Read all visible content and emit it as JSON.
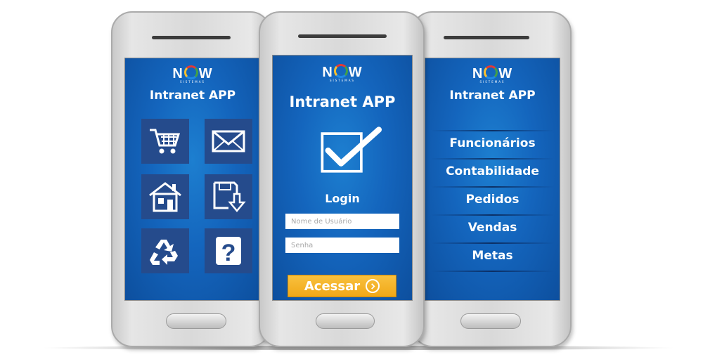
{
  "brand": {
    "logo_left": "N",
    "logo_right": "W",
    "logo_sub": "SISTEMAS"
  },
  "app_title": "Intranet APP",
  "phone1": {
    "tiles": [
      {
        "icon": "shopping-cart-icon"
      },
      {
        "icon": "envelope-icon"
      },
      {
        "icon": "house-icon"
      },
      {
        "icon": "save-download-icon"
      },
      {
        "icon": "recycle-icon"
      },
      {
        "icon": "help-question-icon"
      }
    ]
  },
  "phone2": {
    "check_icon": "checkbox-check-icon",
    "login_label": "Login",
    "username_placeholder": "Nome de Usuário",
    "password_placeholder": "Senha",
    "access_button": "Acessar"
  },
  "phone3": {
    "menu": [
      "Funcionários",
      "Contabilidade",
      "Pedidos",
      "Vendas",
      "Metas"
    ]
  },
  "colors": {
    "screen_blue": "#1465bd",
    "tile": "#254b8c",
    "button_orange": "#f0a818"
  }
}
